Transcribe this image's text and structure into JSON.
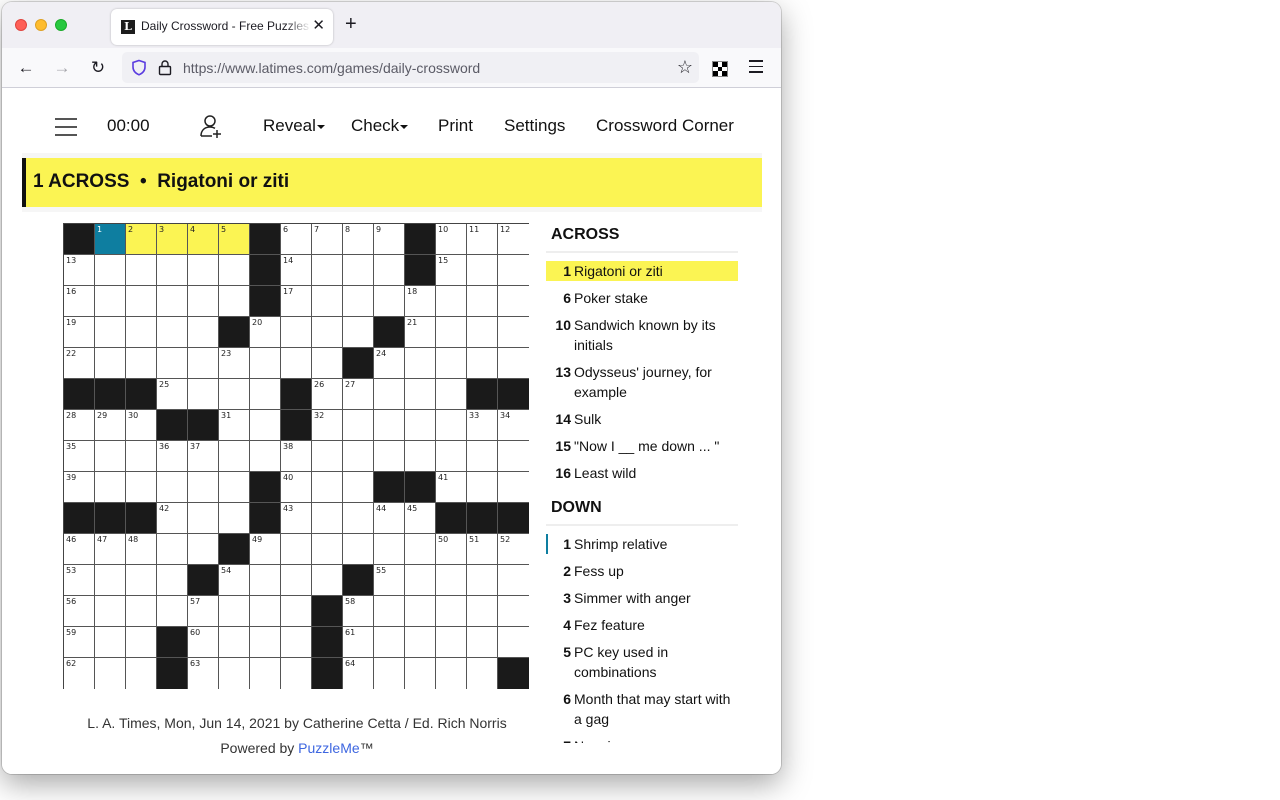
{
  "browser": {
    "tab_title": "Daily Crossword - Free Puzzles for Adults",
    "tab_favicon": "L",
    "new_tab_label": "+",
    "url": "https://www.latimes.com/games/daily-crossword",
    "icons": {
      "back": "←",
      "forward": "→",
      "reload": "↻",
      "bookmark": "☆",
      "close": "✕"
    }
  },
  "toolbar": {
    "timer": "00:00",
    "reveal_label": "Reveal",
    "check_label": "Check",
    "print_label": "Print",
    "settings_label": "Settings",
    "corner_label": "Crossword Corner"
  },
  "current_clue": {
    "text": "1 ACROSS  •  Rigatoni or ziti",
    "number": 1,
    "direction": "ACROSS"
  },
  "grid": {
    "size": 15,
    "rows": [
      "#.....#....#...",
      "......#....#...",
      "......#........",
      ".....#....#....",
      ".........#.....",
      "###....#.....##",
      "...##..#.......",
      "...............",
      "......#...##...",
      "###...#.....###",
      ".....#.........",
      "....#....#.....",
      "........#......",
      "...#....#......",
      "...#....#.....#"
    ],
    "selected_cell": [
      0,
      1
    ],
    "highlighted_cells": [
      [
        0,
        1
      ],
      [
        0,
        2
      ],
      [
        0,
        3
      ],
      [
        0,
        4
      ],
      [
        0,
        5
      ]
    ]
  },
  "clues": {
    "across_title": "ACROSS",
    "down_title": "DOWN",
    "across": [
      {
        "num": "1",
        "text": "Rigatoni or ziti",
        "active": true
      },
      {
        "num": "6",
        "text": "Poker stake"
      },
      {
        "num": "10",
        "text": "Sandwich known by its initials"
      },
      {
        "num": "13",
        "text": "Odysseus' journey, for example"
      },
      {
        "num": "14",
        "text": "Sulk"
      },
      {
        "num": "15",
        "text": "\"Now I __ me down ... \""
      },
      {
        "num": "16",
        "text": "Least wild"
      }
    ],
    "down": [
      {
        "num": "1",
        "text": "Shrimp relative",
        "crossing": true
      },
      {
        "num": "2",
        "text": "Fess up"
      },
      {
        "num": "3",
        "text": "Simmer with anger"
      },
      {
        "num": "4",
        "text": "Fez feature"
      },
      {
        "num": "5",
        "text": "PC key used in combinations"
      },
      {
        "num": "6",
        "text": "Month that may start with a gag"
      },
      {
        "num": "7",
        "text": "Noggin"
      }
    ]
  },
  "credits": {
    "line": "L. A. Times, Mon, Jun 14, 2021 by Catherine Cetta / Ed. Rich Norris",
    "powered_prefix": "Powered by ",
    "powered_link": "PuzzleMe",
    "powered_suffix": "™"
  },
  "colors": {
    "highlight": "#fbf453",
    "selected": "#0e7ea0",
    "black_square": "#1a1a1a",
    "link": "#3d66e0"
  }
}
